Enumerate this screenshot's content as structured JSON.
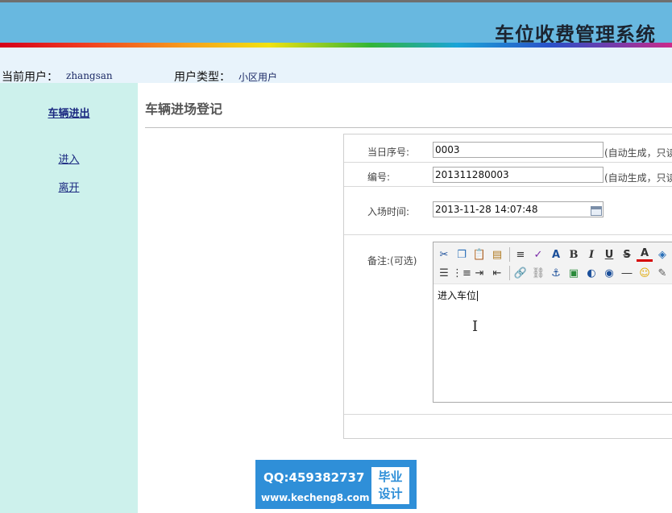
{
  "app": {
    "title": "车位收费管理系统"
  },
  "user_bar": {
    "current_user_label": "当前用户：",
    "current_user": "zhangsan",
    "user_type_label": "用户类型：",
    "user_type": "小区用户"
  },
  "sidebar": {
    "section_title": "车辆进出",
    "items": [
      {
        "label": "进入"
      },
      {
        "label": "离开"
      }
    ]
  },
  "main": {
    "title": "车辆进场登记",
    "form": {
      "daily_seq": {
        "label": "当日序号:",
        "value": "0003",
        "note": "(自动生成，只读"
      },
      "number": {
        "label": "编号:",
        "value": "201311280003",
        "note": "(自动生成，只读"
      },
      "entry_time": {
        "label": "入场时间:",
        "value": "2013-11-28 14:07:48"
      },
      "remark": {
        "label": "备注:(可选)",
        "content": "进入车位"
      }
    },
    "editor_toolbar": {
      "row1": [
        "cut-icon",
        "copy-icon",
        "paste-icon",
        "paste-text-icon",
        "separator",
        "line-spacing-icon",
        "spellcheck-icon",
        "font-size-icon",
        "bold-icon",
        "italic-icon",
        "underline-icon",
        "strikethrough-icon",
        "font-color-icon",
        "highlight-icon"
      ],
      "row2": [
        "align-icon",
        "list-icon",
        "indent-icon",
        "outdent-icon",
        "separator",
        "link-icon",
        "unlink-icon",
        "anchor-icon",
        "image-icon",
        "flash-icon",
        "media-icon",
        "horizontal-rule-icon",
        "emoticon-icon",
        "edit-icon"
      ],
      "glyphs": {
        "bold": "B",
        "italic": "I",
        "underline": "U",
        "strikethrough": "S",
        "font_color": "A"
      }
    }
  },
  "watermark": {
    "qq": "QQ:459382737",
    "url": "www.kecheng8.com",
    "badge_line1": "毕业",
    "badge_line2": "设计"
  },
  "colors": {
    "header": "#68b8e0",
    "sidebar": "#cdf1ec",
    "userbar": "#e8f3fb",
    "link": "#1a2880",
    "watermark": "#2f8fd8"
  }
}
